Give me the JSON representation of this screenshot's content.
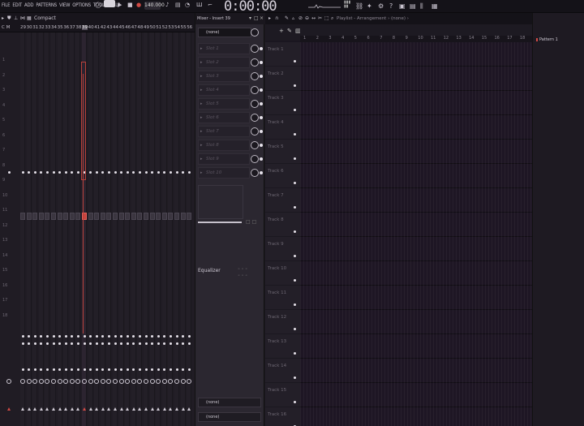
{
  "menu": [
    "FILE",
    "EDIT",
    "ADD",
    "PATTERNS",
    "VIEW",
    "OPTIONS",
    "TOOLS",
    "HELP"
  ],
  "transport": {
    "tempo": "140.000",
    "time": "0:00:00"
  },
  "mixer": {
    "view_label": "Compact",
    "left_label": "C M",
    "selected_insert": "39",
    "numbers": [
      "29",
      "30",
      "31",
      "32",
      "33",
      "34",
      "35",
      "36",
      "37",
      "38",
      "39",
      "40",
      "41",
      "42",
      "43",
      "44",
      "45",
      "46",
      "47",
      "48",
      "49",
      "50",
      "51",
      "52",
      "53",
      "54",
      "55",
      "56"
    ],
    "side_numbers": [
      "1",
      "2",
      "3",
      "4",
      "5",
      "6",
      "7",
      "8",
      "9",
      "10",
      "11",
      "12",
      "13",
      "14",
      "15",
      "16",
      "17",
      "18"
    ]
  },
  "insert_panel": {
    "title": "Mixer - Insert 39",
    "input": "(none)",
    "slots": [
      "Slot 1",
      "Slot 2",
      "Slot 3",
      "Slot 4",
      "Slot 5",
      "Slot 6",
      "Slot 7",
      "Slot 8",
      "Slot 9",
      "Slot 10"
    ],
    "equalizer_label": "Equalizer",
    "out1": "(none)",
    "out2": "(none)"
  },
  "playlist": {
    "title": "Playlist - Arrangement › (none) ›",
    "ruler": [
      "1",
      "2",
      "3",
      "4",
      "5",
      "6",
      "7",
      "8",
      "9",
      "10",
      "11",
      "12",
      "13",
      "14",
      "15",
      "16",
      "17",
      "18"
    ],
    "tracks": [
      "Track 1",
      "Track 2",
      "Track 3",
      "Track 4",
      "Track 5",
      "Track 6",
      "Track 7",
      "Track 8",
      "Track 9",
      "Track 10",
      "Track 11",
      "Track 12",
      "Track 13",
      "Track 14",
      "Track 15",
      "Track 16"
    ]
  },
  "pattern_panel": {
    "label": "Pattern 1"
  },
  "colors": {
    "accent_red": "#d14a44",
    "background": "#1c1820"
  }
}
